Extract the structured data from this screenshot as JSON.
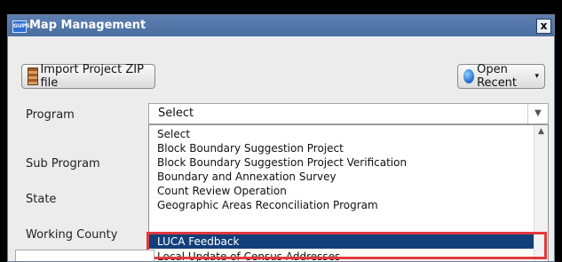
{
  "window": {
    "title": "Map Management",
    "close_label": "x",
    "icon_text": "GUPS"
  },
  "toolbar": {
    "import_label": "Import Project ZIP file",
    "open_recent_label": "Open Recent"
  },
  "form": {
    "program_label": "Program",
    "sub_program_label": "Sub Program",
    "state_label": "State",
    "working_county_label": "Working County",
    "program_value": "Select"
  },
  "dropdown": {
    "options": [
      "Select",
      "Block Boundary Suggestion Project",
      "Block Boundary Suggestion Project Verification",
      "Boundary and Annexation Survey",
      "Count Review Operation",
      "Geographic Areas Reconciliation Program",
      "LUCA Feedback",
      "Local Update of Census Addresses"
    ],
    "selected": "LUCA Feedback"
  }
}
